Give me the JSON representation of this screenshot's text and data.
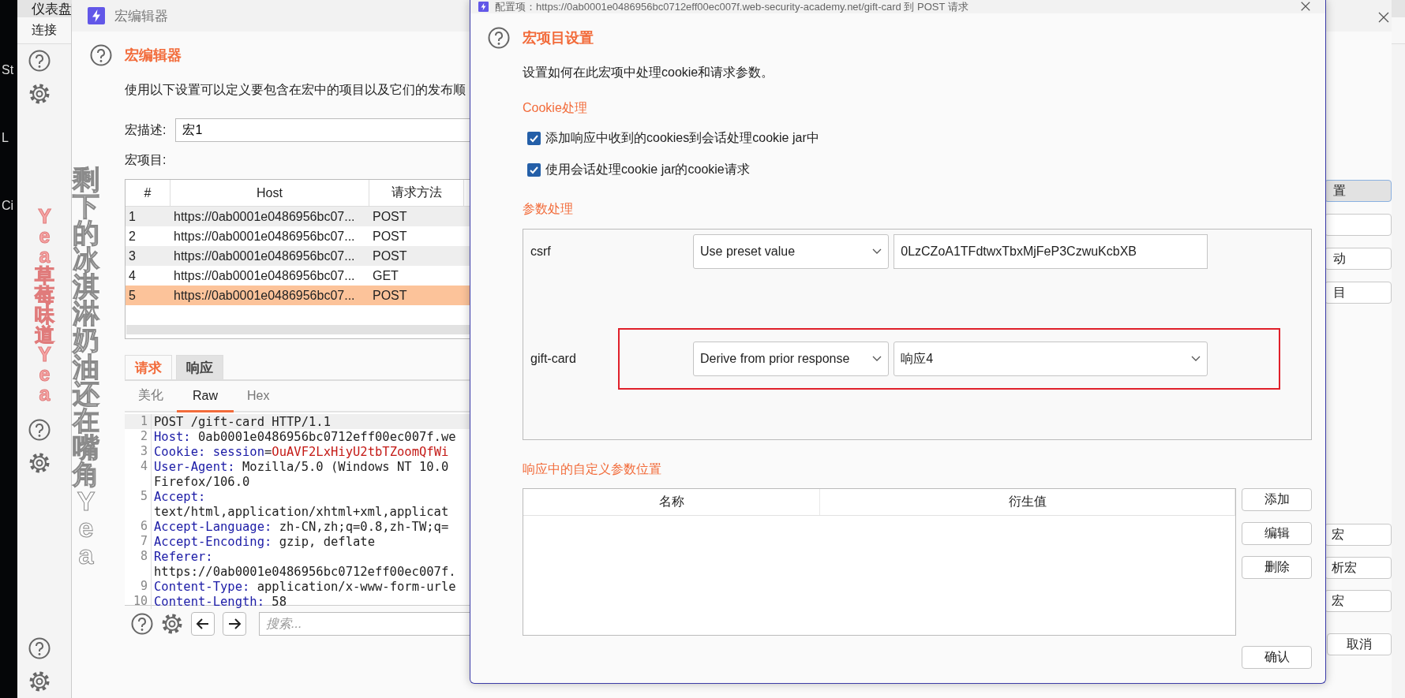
{
  "desktop": {
    "labels": [
      "St",
      "L",
      "Ci"
    ]
  },
  "main_window": {
    "top_tab": "仪表盘",
    "sub_tab": "连接"
  },
  "macro_editor": {
    "title": "宏编辑器",
    "heading": "宏编辑器",
    "description": "使用以下设置可以定义要包含在宏中的项目以及它们的发布顺",
    "description_label": "宏描述:",
    "description_value": "宏1",
    "items_label": "宏项目:",
    "table": {
      "columns": [
        "#",
        "Host",
        "请求方法"
      ],
      "rows": [
        {
          "cells": [
            "1",
            "https://0ab0001e0486956bc07...",
            "POST"
          ],
          "selected": false
        },
        {
          "cells": [
            "2",
            "https://0ab0001e0486956bc07...",
            "POST"
          ],
          "selected": false
        },
        {
          "cells": [
            "3",
            "https://0ab0001e0486956bc07...",
            "POST"
          ],
          "selected": false
        },
        {
          "cells": [
            "4",
            "https://0ab0001e0486956bc07...",
            "GET"
          ],
          "selected": false
        },
        {
          "cells": [
            "5",
            "https://0ab0001e0486956bc07...",
            "POST"
          ],
          "selected": true
        }
      ]
    },
    "tabs": [
      {
        "label": "请求",
        "selected": true
      },
      {
        "label": "响应",
        "selected": false
      }
    ],
    "view_tabs": [
      {
        "label": "美化",
        "selected": false
      },
      {
        "label": "Raw",
        "selected": true
      },
      {
        "label": "Hex",
        "selected": false
      }
    ],
    "editor_lines": [
      {
        "number": "1",
        "current": true,
        "segments": [
          {
            "kind": "plain",
            "text": "POST /gift-card HTTP/1.1"
          }
        ]
      },
      {
        "number": "2",
        "current": false,
        "segments": [
          {
            "kind": "header",
            "text": "Host:"
          },
          {
            "kind": "plain",
            "text": " 0ab0001e0486956bc0712eff00ec007f.we"
          }
        ]
      },
      {
        "number": "3",
        "current": false,
        "segments": [
          {
            "kind": "header",
            "text": "Cookie:"
          },
          {
            "kind": "cookie-name",
            "text": " session"
          },
          {
            "kind": "plain",
            "text": "="
          },
          {
            "kind": "cookie-value",
            "text": "OuAVF2LxHiyU2tbTZoomQfWi"
          }
        ]
      },
      {
        "number": "4",
        "current": false,
        "segments": [
          {
            "kind": "header",
            "text": "User-Agent:"
          },
          {
            "kind": "plain",
            "text": " Mozilla/5.0 (Windows NT 10.0"
          }
        ]
      },
      {
        "current": false,
        "segments": [
          {
            "kind": "plain",
            "text": "Firefox/106.0"
          }
        ]
      },
      {
        "number": "5",
        "current": false,
        "segments": [
          {
            "kind": "header",
            "text": "Accept:"
          }
        ]
      },
      {
        "current": false,
        "segments": [
          {
            "kind": "plain",
            "text": "text/html,application/xhtml+xml,applicat"
          }
        ]
      },
      {
        "number": "6",
        "current": false,
        "segments": [
          {
            "kind": "header",
            "text": "Accept-Language:"
          },
          {
            "kind": "plain",
            "text": " zh-CN,zh;q=0.8,zh-TW;q="
          }
        ]
      },
      {
        "number": "7",
        "current": false,
        "segments": [
          {
            "kind": "header",
            "text": "Accept-Encoding:"
          },
          {
            "kind": "plain",
            "text": " gzip, deflate"
          }
        ]
      },
      {
        "number": "8",
        "current": false,
        "segments": [
          {
            "kind": "header",
            "text": "Referer:"
          }
        ]
      },
      {
        "current": false,
        "segments": [
          {
            "kind": "plain",
            "text": "https://0ab0001e0486956bc0712eff00ec007f."
          }
        ]
      },
      {
        "number": "9",
        "current": false,
        "segments": [
          {
            "kind": "header",
            "text": "Content-Type:"
          },
          {
            "kind": "plain",
            "text": " application/x-www-form-urle"
          }
        ]
      },
      {
        "number": "10",
        "current": false,
        "segments": [
          {
            "kind": "header",
            "text": "Content-Length:"
          },
          {
            "kind": "plain",
            "text": " 58"
          }
        ]
      }
    ],
    "search_placeholder": "搜索...",
    "side_buttons": [
      {
        "label": "置",
        "focused": true
      },
      {
        "focused": false
      },
      {
        "label": "动",
        "focused": false
      },
      {
        "label": "目",
        "focused": false
      }
    ],
    "lower_buttons": [
      {
        "label": "宏"
      },
      {
        "label": "析宏"
      },
      {
        "label": "宏"
      }
    ],
    "cancel": "取消"
  },
  "dialog": {
    "title": "配置项：https://0ab0001e0486956bc0712eff00ec007f.web-security-academy.net/gift-card 到 POST 请求",
    "heading": "宏项目设置",
    "description": "设置如何在此宏项中处理cookie和请求参数。",
    "cookie_section": "Cookie处理",
    "cookie_options": [
      {
        "label": "添加响应中收到的cookies到会话处理cookie jar中",
        "checked": true
      },
      {
        "label": "使用会话处理cookie jar的cookie请求",
        "checked": true
      }
    ],
    "param_section": "参数处理",
    "parameters": [
      {
        "name": "csrf",
        "mode": "Use preset value",
        "value": {
          "kind": "text",
          "text": "0LzCZoA1TFdtwxTbxMjFeP3CzwuKcbXB"
        },
        "highlighted": false
      },
      {
        "name": "gift-card",
        "mode": "Derive from prior response",
        "value": {
          "kind": "dropdown",
          "text": "响应4"
        },
        "highlighted": true
      }
    ],
    "custom_section": "响应中的自定义参数位置",
    "custom_table": {
      "columns": [
        "名称",
        "衍生值"
      ]
    },
    "table_buttons": [
      "添加",
      "编辑",
      "删除"
    ],
    "confirm": "确认"
  },
  "lyrics": [
    {
      "kind": "pink",
      "text": "Yea草莓味道Yea"
    },
    {
      "kind": "outline",
      "text": "剩下的冰淇淋奶油还在嘴角Yea"
    }
  ]
}
